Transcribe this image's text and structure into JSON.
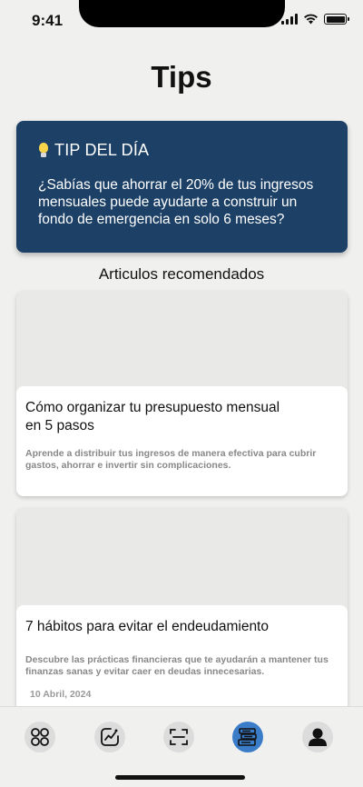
{
  "status_bar": {
    "time": "9:41"
  },
  "page": {
    "title": "Tips"
  },
  "tip_of_day": {
    "icon": "lightbulb-icon",
    "heading": "TIP DEL DÍA",
    "text": "¿Sabías que ahorrar el 20% de tus ingresos mensuales puede ayudarte a construir un fondo de emergencia en solo 6 meses?",
    "background_color": "#1c4066"
  },
  "articles": {
    "section_title": "Articulos recomendados",
    "items": [
      {
        "title": "Cómo organizar tu presupuesto mensual en 5 pasos",
        "description": "Aprende a distribuir tus ingresos de manera efectiva para cubrir gastos, ahorrar e invertir sin complicaciones."
      },
      {
        "title": "7 hábitos para evitar el endeudamiento",
        "description": "Descubre las prácticas financieras que te ayudarán a mantener tus finanzas sanas y evitar caer en deudas innecesarias.",
        "date": "10 Abril, 2024"
      }
    ]
  },
  "bottom_nav": {
    "items": [
      {
        "icon": "grid-icon",
        "active": false
      },
      {
        "icon": "chart-icon",
        "active": false
      },
      {
        "icon": "scan-icon",
        "active": false
      },
      {
        "icon": "books-icon",
        "active": true
      },
      {
        "icon": "profile-icon",
        "active": false
      }
    ],
    "active_color": "#3b7cc9"
  }
}
